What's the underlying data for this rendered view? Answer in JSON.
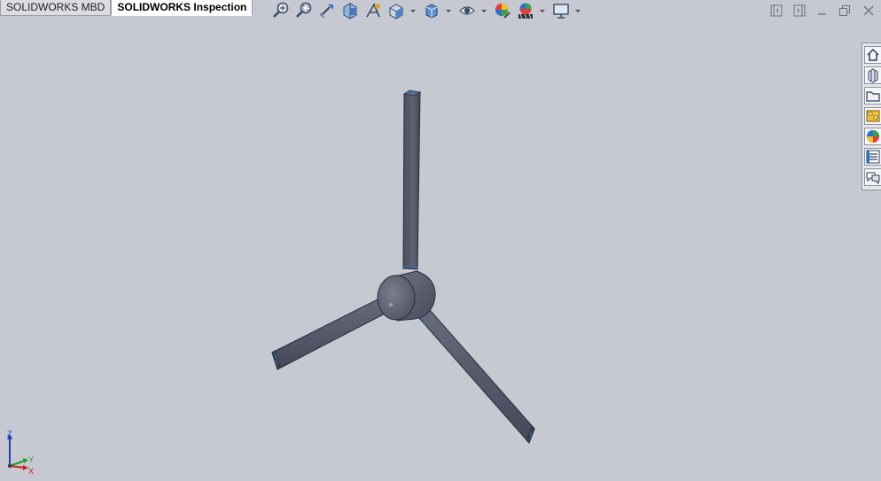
{
  "command_tabs": [
    {
      "label": "SOLIDWORKS MBD",
      "active": false
    },
    {
      "label": "SOLIDWORKS Inspection",
      "active": true
    }
  ],
  "view_toolbar": [
    "zoom-to-fit-icon",
    "zoom-to-area-icon",
    "previous-view-icon",
    "section-view-icon",
    "dynamic-annotation-views-icon",
    "view-orientation-icon",
    "display-style-icon",
    "hide-show-items-icon",
    "edit-appearance-icon",
    "apply-scene-icon",
    "view-settings-icon"
  ],
  "task_pane": [
    "solidworks-resources-icon",
    "design-library-icon",
    "file-explorer-icon",
    "view-palette-icon",
    "appearances-scenes-icon",
    "custom-properties-icon",
    "forum-icon"
  ],
  "window_controls": [
    "tile-left-icon",
    "tile-right-icon",
    "minimize-icon",
    "restore-icon",
    "close-icon"
  ],
  "triad": {
    "z_label": "Z",
    "y_label": "Y",
    "x_label": "X"
  },
  "colors": {
    "viewport_background": "#c6c9d1",
    "model_body": "#5a5e6e",
    "edge_highlight": "#2c6fb5",
    "triad_x": "#d21e1e",
    "triad_y": "#1f9a2e",
    "triad_z": "#1f3fb5"
  }
}
